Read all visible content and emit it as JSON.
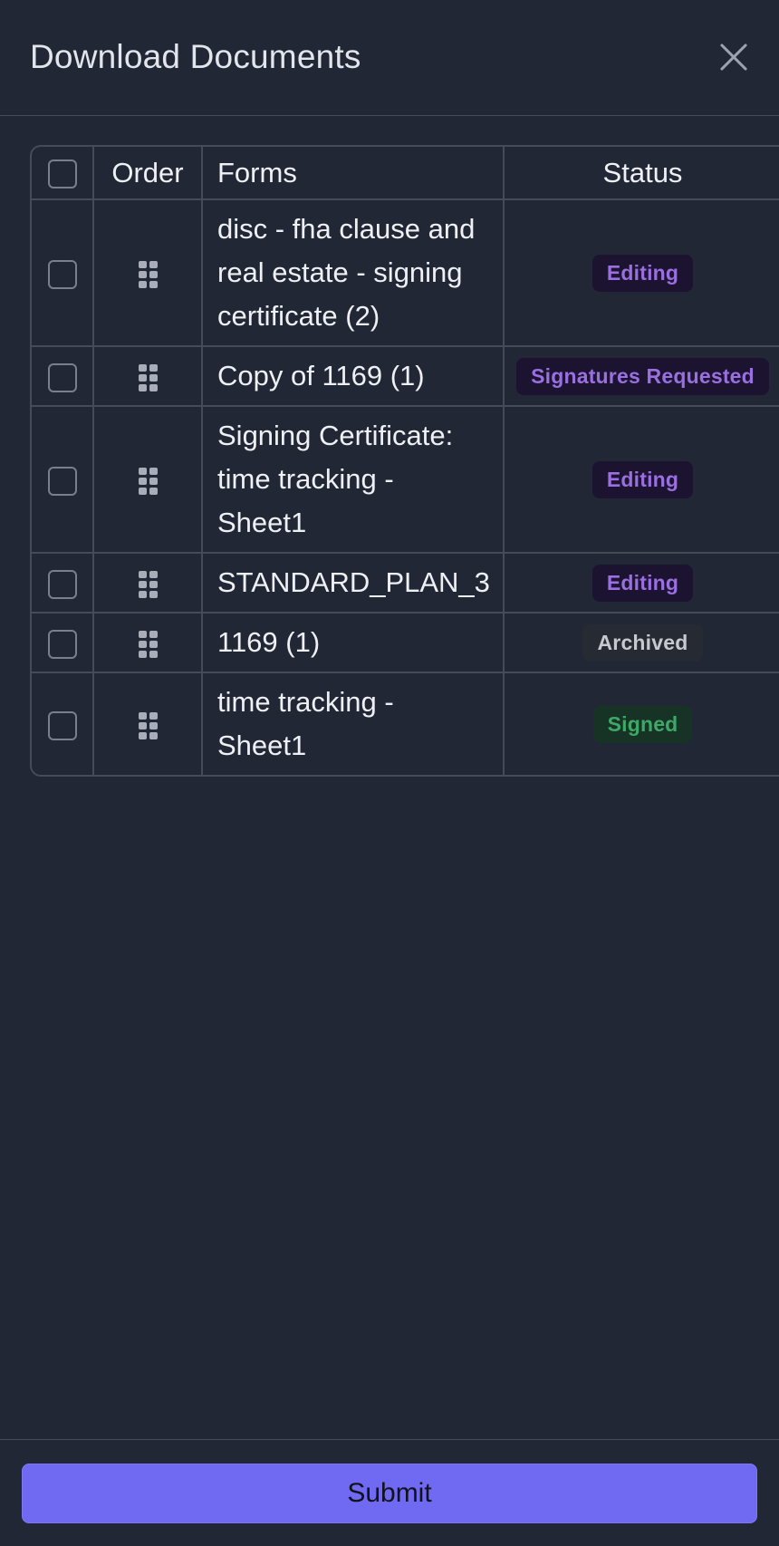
{
  "modal": {
    "title": "Download Documents"
  },
  "table": {
    "headers": {
      "order": "Order",
      "forms": "Forms",
      "status": "Status"
    },
    "rows": [
      {
        "form": "disc - fha clause and real estate - signing certificate (2)",
        "status": "Editing",
        "status_kind": "editing"
      },
      {
        "form": "Copy of 1169 (1)",
        "status": "Signatures Requested",
        "status_kind": "requested"
      },
      {
        "form": "Signing Certificate: time tracking - Sheet1",
        "status": "Editing",
        "status_kind": "editing"
      },
      {
        "form": "STANDARD_PLAN_3",
        "status": "Editing",
        "status_kind": "editing"
      },
      {
        "form": "1169 (1)",
        "status": "Archived",
        "status_kind": "archived"
      },
      {
        "form": "time tracking - Sheet1",
        "status": "Signed",
        "status_kind": "signed"
      }
    ]
  },
  "footer": {
    "submit_label": "Submit"
  },
  "icons": {
    "close": "close-icon",
    "drag": "drag-handle-icon",
    "checkbox": "checkbox"
  },
  "colors": {
    "background": "#222736",
    "border": "#454b5b",
    "submit": "#7069f2",
    "editing_text": "#9a6fe0",
    "signed_text": "#3ea867",
    "archived_text": "#c6c9cf"
  }
}
